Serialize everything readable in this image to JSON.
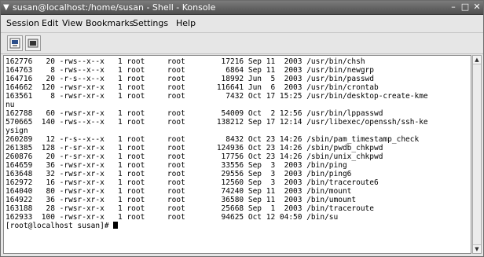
{
  "window": {
    "title": "susan@localhost:/home/susan - Shell - Konsole",
    "buttons": {
      "minimize": "–",
      "maximize": "□",
      "close": "✕"
    }
  },
  "menubar": {
    "items": [
      "Session",
      "Edit",
      "View",
      "Bookmarks",
      "Settings",
      "Help"
    ]
  },
  "toolbar": {
    "icons": [
      "new-session-icon",
      "terminal-icon"
    ]
  },
  "terminal": {
    "lines": [
      "162776   20 -rws--x--x   1 root     root        17216 Sep 11  2003 /usr/bin/chsh",
      "164763    8 -rws--x--x   1 root     root         6864 Sep 11  2003 /usr/bin/newgrp",
      "164716   20 -r-s--x--x   1 root     root        18992 Jun  5  2003 /usr/bin/passwd",
      "164662  120 -rwsr-xr-x   1 root     root       116641 Jun  6  2003 /usr/bin/crontab",
      "163561    8 -rwsr-xr-x   1 root     root         7432 Oct 17 15:25 /usr/bin/desktop-create-kme",
      "nu",
      "162788   60 -rwsr-xr-x   1 root     root        54009 Oct  2 12:56 /usr/bin/lppasswd",
      "570665  140 -rws--x--x   1 root     root       138212 Sep 17 12:14 /usr/libexec/openssh/ssh-ke",
      "ysign",
      "260289   12 -r-s--x--x   1 root     root         8432 Oct 23 14:26 /sbin/pam_timestamp_check",
      "261385  128 -r-sr-xr-x   1 root     root       124936 Oct 23 14:26 /sbin/pwdb_chkpwd",
      "260876   20 -r-sr-xr-x   1 root     root        17756 Oct 23 14:26 /sbin/unix_chkpwd",
      "164659   36 -rwsr-xr-x   1 root     root        33556 Sep  3  2003 /bin/ping",
      "163648   32 -rwsr-xr-x   1 root     root        29556 Sep  3  2003 /bin/ping6",
      "162972   16 -rwsr-xr-x   1 root     root        12560 Sep  3  2003 /bin/traceroute6",
      "164040   80 -rwsr-xr-x   1 root     root        74240 Sep 11  2003 /bin/mount",
      "164922   36 -rwsr-xr-x   1 root     root        36580 Sep 11  2003 /bin/umount",
      "163188   28 -rwsr-xr-x   1 root     root        25668 Sep  1  2003 /bin/traceroute",
      "162933  100 -rwsr-xr-x   1 root     root        94625 Oct 12 04:50 /bin/su"
    ],
    "prompt": "[root@localhost susan]# "
  },
  "scrollbar": {
    "up_arrow": "▲",
    "down_arrow": "▼"
  }
}
